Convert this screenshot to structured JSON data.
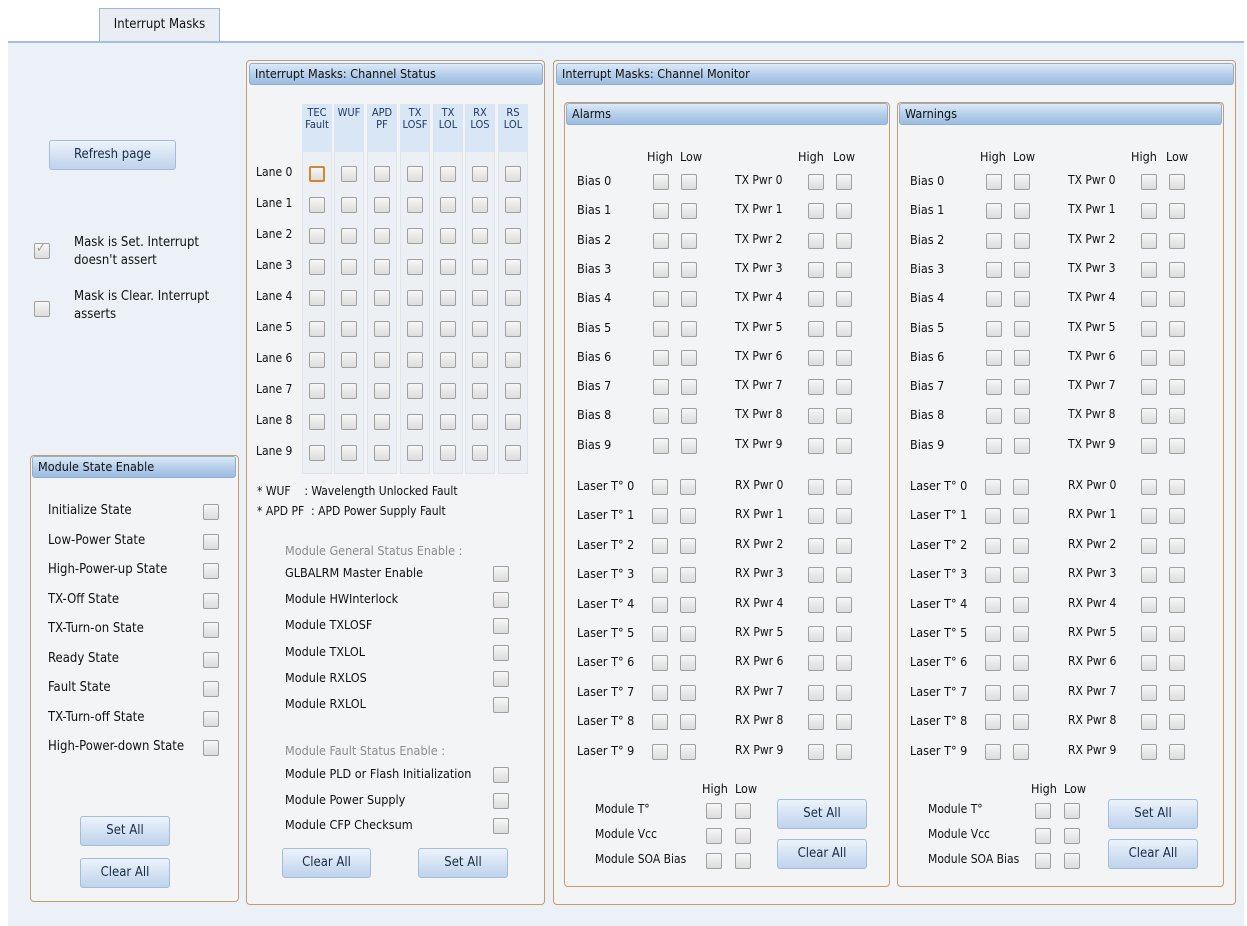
{
  "tab": {
    "label": "Interrupt Masks"
  },
  "left": {
    "refresh_label": "Refresh page",
    "legend_set": "Mask is Set. Interrupt doesn't assert",
    "legend_clear": "Mask is Clear. Interrupt asserts",
    "module_state": {
      "title": "Module State Enable",
      "items": [
        "Initialize State",
        "Low-Power State",
        "High-Power-up State",
        "TX-Off State",
        "TX-Turn-on State",
        "Ready State",
        "Fault State",
        "TX-Turn-off State",
        "High-Power-down State"
      ],
      "set_all_label": "Set All",
      "clear_all_label": "Clear All"
    }
  },
  "channel_status": {
    "title": "Interrupt Masks: Channel Status",
    "columns": [
      {
        "line1": "TEC",
        "line2": "Fault"
      },
      {
        "line1": "WUF",
        "line2": ""
      },
      {
        "line1": "APD",
        "line2": "PF"
      },
      {
        "line1": "TX",
        "line2": "LOSF"
      },
      {
        "line1": "TX",
        "line2": "LOL"
      },
      {
        "line1": "RX",
        "line2": "LOS"
      },
      {
        "line1": "RS",
        "line2": "LOL"
      }
    ],
    "lanes": [
      "Lane 0",
      "Lane 1",
      "Lane 2",
      "Lane 3",
      "Lane 4",
      "Lane 5",
      "Lane 6",
      "Lane 7",
      "Lane 8",
      "Lane 9"
    ],
    "note_wuf": "* WUF    : Wavelength Unlocked Fault",
    "note_apd": "* APD PF  : APD Power Supply Fault",
    "general_title": "Module General Status Enable :",
    "general_items": [
      "GLBALRM Master Enable",
      "Module HWInterlock",
      "Module TXLOSF",
      "Module TXLOL",
      "Module RXLOS",
      "Module RXLOL"
    ],
    "fault_title": "Module Fault Status Enable :",
    "fault_items": [
      "Module PLD or Flash Initialization",
      "Module Power Supply",
      "Module CFP Checksum"
    ],
    "clear_all_label": "Clear All",
    "set_all_label": "Set All"
  },
  "channel_monitor": {
    "title": "Interrupt Masks: Channel Monitor",
    "high_label": "High",
    "low_label": "Low",
    "bias": [
      "Bias 0",
      "Bias 1",
      "Bias 2",
      "Bias 3",
      "Bias 4",
      "Bias 5",
      "Bias 6",
      "Bias 7",
      "Bias 8",
      "Bias 9"
    ],
    "tx_pwr": [
      "TX Pwr 0",
      "TX Pwr 1",
      "TX Pwr 2",
      "TX Pwr 3",
      "TX Pwr 4",
      "TX Pwr 5",
      "TX Pwr 6",
      "TX Pwr 7",
      "TX Pwr 8",
      "TX Pwr 9"
    ],
    "laser_t": [
      "Laser T° 0",
      "Laser T° 1",
      "Laser T° 2",
      "Laser T° 3",
      "Laser T° 4",
      "Laser T° 5",
      "Laser T° 6",
      "Laser T° 7",
      "Laser T° 8",
      "Laser T° 9"
    ],
    "rx_pwr": [
      "RX Pwr 0",
      "RX Pwr 1",
      "RX Pwr 2",
      "RX Pwr 3",
      "RX Pwr 4",
      "RX Pwr 5",
      "RX Pwr 6",
      "RX Pwr 7",
      "RX Pwr 8",
      "RX Pwr 9"
    ],
    "module_items": [
      "Module T°",
      "Module Vcc",
      "Module SOA Bias"
    ],
    "alarms": {
      "title": "Alarms",
      "set_all_label": "Set All",
      "clear_all_label": "Clear All"
    },
    "warnings": {
      "title": "Warnings",
      "set_all_label": "Set All",
      "clear_all_label": "Clear All"
    }
  }
}
